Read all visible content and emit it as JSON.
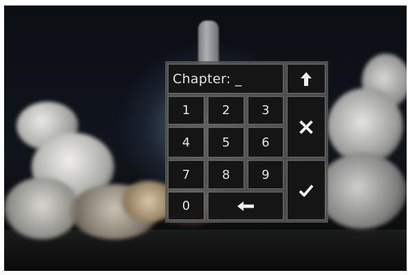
{
  "keypad": {
    "display": "Chapter: _",
    "digits": [
      "1",
      "2",
      "3",
      "4",
      "5",
      "6",
      "7",
      "8",
      "9",
      "0"
    ],
    "icons": {
      "up": "arrow-up-icon",
      "cancel": "close-icon",
      "backspace": "arrow-left-icon",
      "confirm": "checkmark-icon"
    }
  },
  "colors": {
    "key_background": "#151515",
    "key_border": "#6d6d6d",
    "panel_background": "#585858",
    "text": "#e6e6e6"
  }
}
